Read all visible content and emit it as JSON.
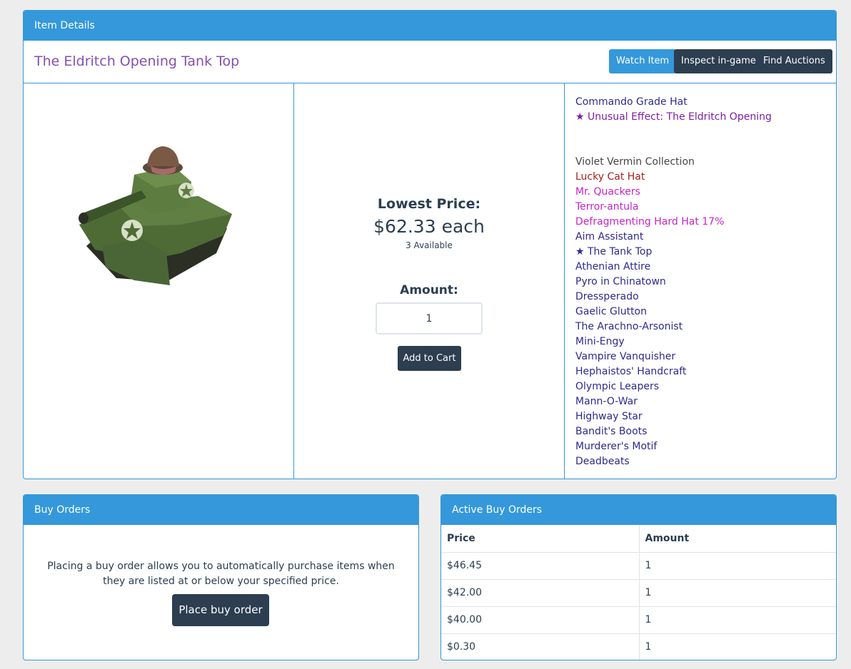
{
  "details": {
    "heading": "Item Details",
    "item_name": "The Eldritch Opening Tank Top",
    "buttons": {
      "watch": "Watch Item",
      "inspect": "Inspect in-game",
      "auctions": "Find Auctions"
    },
    "image": "tank-top-image",
    "lowest_price_label": "Lowest Price:",
    "price": "$62.33 each",
    "available": "3 Available",
    "amount_label": "Amount:",
    "amount_value": "1",
    "add_to_cart": "Add to Cart",
    "attributes": [
      {
        "text": "Commando Grade Hat",
        "color": "#2d2a8c"
      },
      {
        "text": "★ Unusual Effect: The Eldritch Opening",
        "color": "#7d1ea5"
      },
      {
        "text": "",
        "color": ""
      },
      {
        "text": "",
        "color": ""
      },
      {
        "text": "Violet Vermin Collection",
        "color": "#454545"
      },
      {
        "text": "Lucky Cat Hat",
        "color": "#a8211f"
      },
      {
        "text": "Mr. Quackers",
        "color": "#c724c7"
      },
      {
        "text": "Terror-antula",
        "color": "#c724c7"
      },
      {
        "text": "Defragmenting Hard Hat 17%",
        "color": "#c724c7"
      },
      {
        "text": "Aim Assistant",
        "color": "#2d2a8c"
      },
      {
        "text": "★ The Tank Top",
        "color": "#2d2a8c"
      },
      {
        "text": "Athenian Attire",
        "color": "#2d2a8c"
      },
      {
        "text": "Pyro in Chinatown",
        "color": "#2d2a8c"
      },
      {
        "text": "Dressperado",
        "color": "#2d2a8c"
      },
      {
        "text": "Gaelic Glutton",
        "color": "#2d2a8c"
      },
      {
        "text": "The Arachno-Arsonist",
        "color": "#2d2a8c"
      },
      {
        "text": "Mini-Engy",
        "color": "#2d2a8c"
      },
      {
        "text": "Vampire Vanquisher",
        "color": "#2d2a8c"
      },
      {
        "text": "Hephaistos' Handcraft",
        "color": "#2d2a8c"
      },
      {
        "text": "Olympic Leapers",
        "color": "#2d2a8c"
      },
      {
        "text": "Mann-O-War",
        "color": "#2d2a8c"
      },
      {
        "text": "Highway Star",
        "color": "#2d2a8c"
      },
      {
        "text": "Bandit's Boots",
        "color": "#2d2a8c"
      },
      {
        "text": "Murderer's Motif",
        "color": "#2d2a8c"
      },
      {
        "text": "Deadbeats",
        "color": "#2d2a8c"
      }
    ]
  },
  "buy_orders": {
    "heading": "Buy Orders",
    "description": "Placing a buy order allows you to automatically purchase items when they are listed at or below your specified price.",
    "button": "Place buy order"
  },
  "active_orders": {
    "heading": "Active Buy Orders",
    "columns": [
      "Price",
      "Amount"
    ],
    "rows": [
      [
        "$46.45",
        "1"
      ],
      [
        "$42.00",
        "1"
      ],
      [
        "$40.00",
        "1"
      ],
      [
        "$0.30",
        "1"
      ]
    ]
  },
  "colors": {
    "accent": "#3498db",
    "dark": "#2c3e50",
    "title": "#8650ac"
  }
}
